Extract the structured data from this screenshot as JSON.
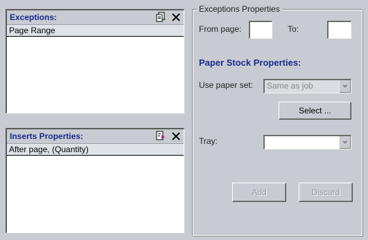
{
  "exceptions": {
    "title": "Exceptions:",
    "column": "Page Range",
    "icons": [
      "add-pages-icon",
      "close-icon"
    ]
  },
  "inserts": {
    "title": "Inserts Properties:",
    "column": "After page, (Quantity)",
    "icons": [
      "insert-page-icon",
      "close-icon"
    ]
  },
  "exceptions_properties": {
    "group_label": "Exceptions Properties",
    "from_label": "From page:",
    "from_value": "",
    "to_label": "To:",
    "to_value": ""
  },
  "paper_stock": {
    "title": "Paper Stock Properties:",
    "use_paper_set_label": "Use paper set:",
    "paper_set_value": "Same as job",
    "select_label": "Select ...",
    "tray_label": "Tray:",
    "tray_value": ""
  },
  "actions": {
    "add_label": "Add",
    "discard_label": "Discard"
  },
  "colors": {
    "title_blue": "#1a2a8c",
    "background": "#c8ccd2"
  }
}
